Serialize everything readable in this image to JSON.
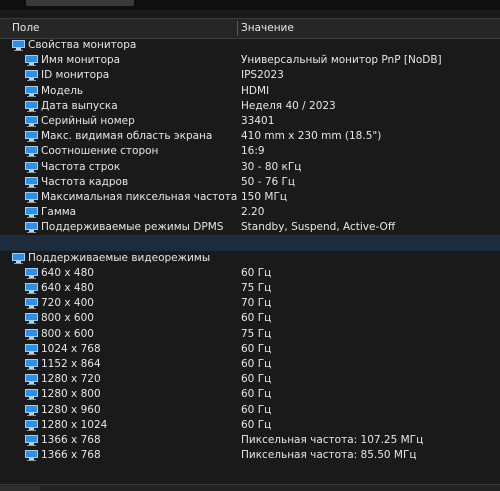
{
  "columns": {
    "field": "Поле",
    "value": "Значение"
  },
  "monitor_group": {
    "label": "Свойства монитора",
    "items": [
      {
        "label": "Имя монитора",
        "value": "Универсальный монитор PnP [NoDB]"
      },
      {
        "label": "ID монитора",
        "value": "IPS2023"
      },
      {
        "label": "Модель",
        "value": "HDMI"
      },
      {
        "label": "Дата выпуска",
        "value": "Неделя 40 / 2023"
      },
      {
        "label": "Серийный номер",
        "value": "33401"
      },
      {
        "label": "Макс. видимая область экрана",
        "value": "410 mm x 230 mm (18.5\")"
      },
      {
        "label": "Соотношение сторон",
        "value": "16:9"
      },
      {
        "label": "Частота строк",
        "value": "30 - 80 кГц"
      },
      {
        "label": "Частота кадров",
        "value": "50 - 76 Гц"
      },
      {
        "label": "Максимальная пиксельная частота",
        "value": "150 МГц"
      },
      {
        "label": "Гамма",
        "value": "2.20"
      },
      {
        "label": "Поддерживаемые режимы DPMS",
        "value": "Standby, Suspend, Active-Off"
      }
    ]
  },
  "modes_group": {
    "label": "Поддерживаемые видеорежимы",
    "items": [
      {
        "label": "640 x 480",
        "value": "60 Гц"
      },
      {
        "label": "640 x 480",
        "value": "75 Гц"
      },
      {
        "label": "720 x 400",
        "value": "70 Гц"
      },
      {
        "label": "800 x 600",
        "value": "60 Гц"
      },
      {
        "label": "800 x 600",
        "value": "75 Гц"
      },
      {
        "label": "1024 x 768",
        "value": "60 Гц"
      },
      {
        "label": "1152 x 864",
        "value": "60 Гц"
      },
      {
        "label": "1280 x 720",
        "value": "60 Гц"
      },
      {
        "label": "1280 x 800",
        "value": "60 Гц"
      },
      {
        "label": "1280 x 960",
        "value": "60 Гц"
      },
      {
        "label": "1280 x 1024",
        "value": "60 Гц"
      },
      {
        "label": "1366 x 768",
        "value": "Пиксельная частота: 107.25 МГц"
      },
      {
        "label": "1366 x 768",
        "value": "Пиксельная частота: 85.50 МГц"
      }
    ]
  },
  "icons": {
    "group": "monitor-icon",
    "item": "monitor-icon"
  },
  "colors": {
    "background": "#1a1a1a",
    "text": "#e6e6e6",
    "icon": "#2f8fe6",
    "selected_row": "#1c2c3c"
  }
}
